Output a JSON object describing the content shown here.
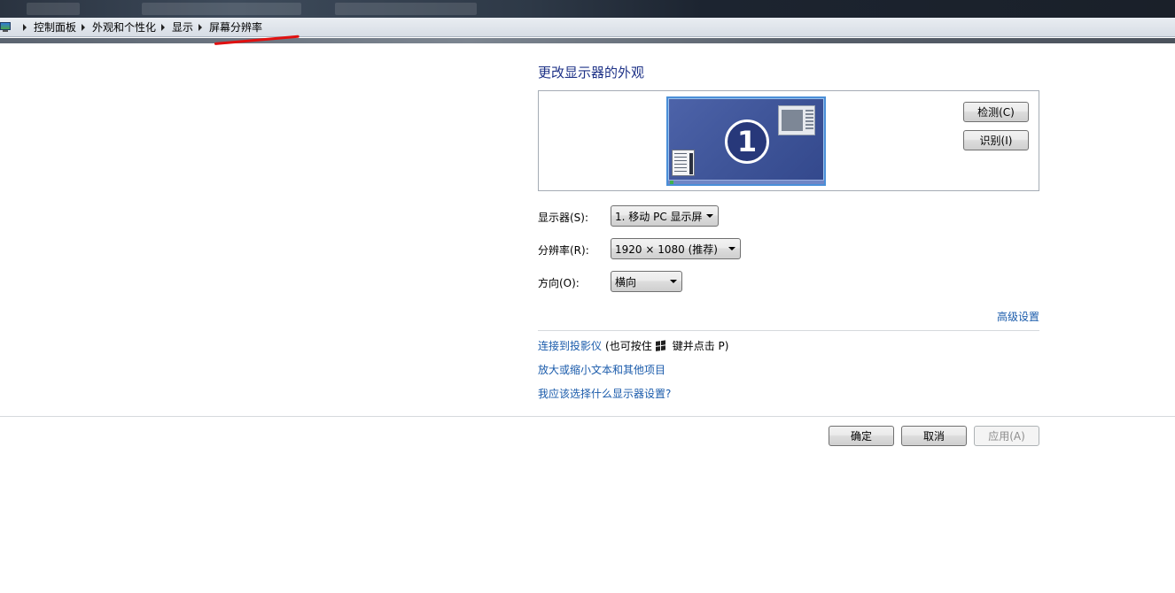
{
  "breadcrumb": {
    "items": [
      "控制面板",
      "外观和个性化",
      "显示",
      "屏幕分辨率"
    ]
  },
  "main": {
    "title": "更改显示器的外观",
    "monitor_number": "1",
    "detect_button": "检测(C)",
    "identify_button": "识别(I)",
    "display_label": "显示器(S):",
    "display_value": "1. 移动 PC 显示屏",
    "resolution_label": "分辨率(R):",
    "resolution_value": "1920 × 1080 (推荐)",
    "orientation_label": "方向(O):",
    "orientation_value": "横向",
    "advanced_link": "高级设置",
    "projector_link": "连接到投影仪",
    "projector_hint_prefix": "(也可按住",
    "projector_hint_suffix": "键并点击 P)",
    "text_size_link": "放大或缩小文本和其他项目",
    "help_link": "我应该选择什么显示器设置?"
  },
  "footer": {
    "ok_button": "确定",
    "cancel_button": "取消",
    "apply_button": "应用(A)"
  },
  "colors": {
    "heading": "#1e3287",
    "link": "#1a5bab",
    "annotation": "#e01010"
  }
}
